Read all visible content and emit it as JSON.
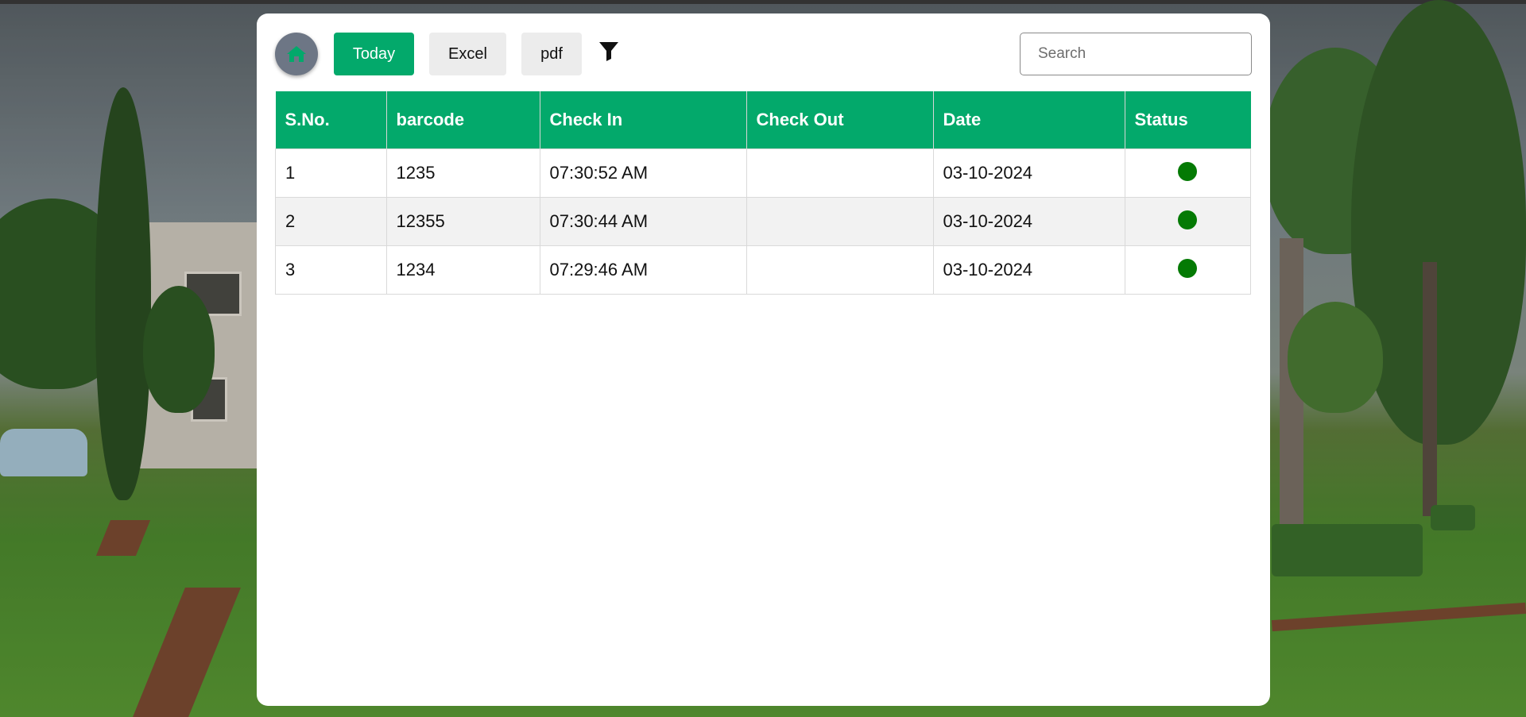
{
  "toolbar": {
    "today_label": "Today",
    "excel_label": "Excel",
    "pdf_label": "pdf",
    "home_icon": "home-icon",
    "filter_icon": "filter-icon",
    "search_placeholder": "Search",
    "search_value": ""
  },
  "table": {
    "headers": [
      "S.No.",
      "barcode",
      "Check In",
      "Check Out",
      "Date",
      "Status"
    ],
    "rows": [
      {
        "sno": "1",
        "barcode": "1235",
        "check_in": "07:30:52 AM",
        "check_out": "",
        "date": "03-10-2024",
        "status": "active"
      },
      {
        "sno": "2",
        "barcode": "12355",
        "check_in": "07:30:44 AM",
        "check_out": "",
        "date": "03-10-2024",
        "status": "active"
      },
      {
        "sno": "3",
        "barcode": "1234",
        "check_in": "07:29:46 AM",
        "check_out": "",
        "date": "03-10-2024",
        "status": "active"
      }
    ]
  },
  "colors": {
    "accent": "#03a96b",
    "status_active": "#047a04",
    "home_button": "#6d7685"
  }
}
